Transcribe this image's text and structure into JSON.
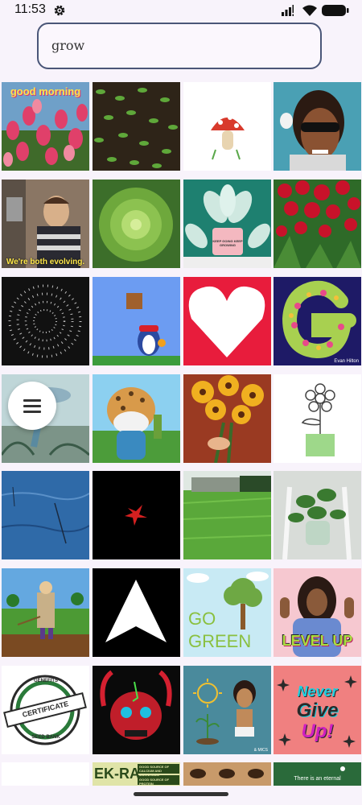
{
  "status": {
    "time": "11:53"
  },
  "search": {
    "value": "grow"
  },
  "icons": {
    "settings": "gear-icon",
    "signal": "signal-icon",
    "wifi": "wifi-icon",
    "battery": "battery-icon",
    "menu": "hamburger-menu-icon"
  },
  "tiles": {
    "good_morning": "good morning",
    "evolving": "We're both evolving.",
    "keep_going": "KEEP GOING KEEP GROWING",
    "evan_hilton": "Evan Hilton",
    "go_green_1": "GO",
    "go_green_2": "GREEN",
    "level_up": "LEVEL UP",
    "cert_top": "GENEFITS",
    "cert_mid": "CERTIFICATE",
    "cert_bot": "SEED BANK",
    "never_1": "Never",
    "never_2": "Give",
    "never_3": "Up!",
    "ekra": "EK-RA",
    "calcium": "GOOD SOURCE OF CALCIUM AND MAGNESIUM",
    "protein": "GOOD SOURCE OF PROTEIN",
    "eternal": "There is an eternal",
    "watermark": "& MICS"
  },
  "colors": {
    "background": "#f8f3fb",
    "search_border": "#4a5678"
  }
}
